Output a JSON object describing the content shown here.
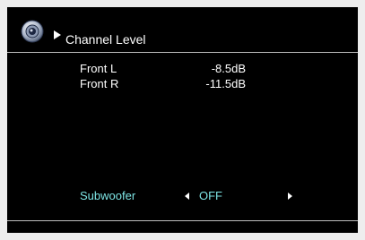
{
  "header": {
    "icon": "speaker-icon",
    "title": "Channel Level"
  },
  "channels": [
    {
      "label": "Front L",
      "value": "-8.5dB"
    },
    {
      "label": "Front R",
      "value": "-11.5dB"
    }
  ],
  "subwoofer": {
    "label": "Subwoofer",
    "value": "OFF"
  },
  "colors": {
    "background": "#000000",
    "text": "#ffffff",
    "highlight": "#7de4e4",
    "divider": "#bdbdbd"
  }
}
